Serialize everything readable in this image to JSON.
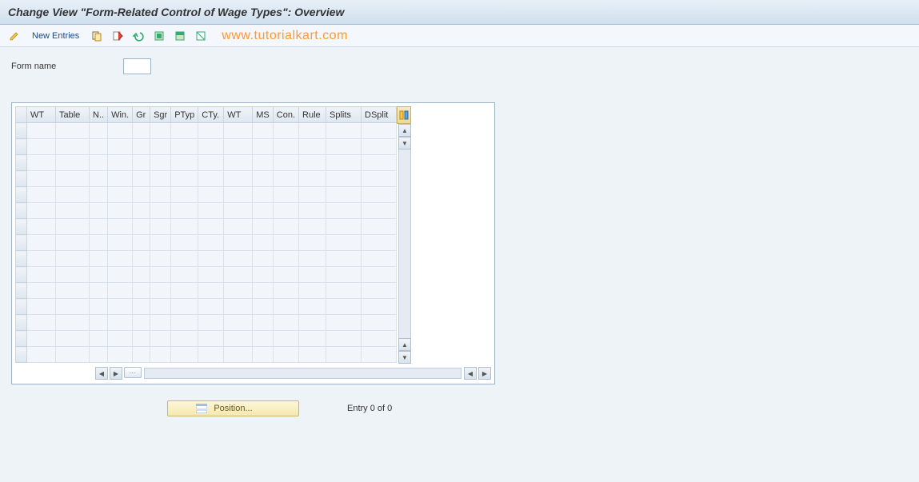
{
  "header": {
    "title": "Change View \"Form-Related Control of Wage Types\": Overview"
  },
  "toolbar": {
    "new_entries": "New Entries",
    "watermark": "www.tutorialkart.com"
  },
  "form": {
    "name_label": "Form name",
    "name_value": ""
  },
  "table": {
    "columns": [
      "WT",
      "Table",
      "N..",
      "Win.",
      "Gr",
      "Sgr",
      "PTyp",
      "CTy.",
      "WT",
      "MS",
      "Con.",
      "Rule",
      "Splits",
      "DSplit"
    ],
    "rows": 15,
    "entry_status": "Entry 0 of 0",
    "position_label": "Position..."
  }
}
